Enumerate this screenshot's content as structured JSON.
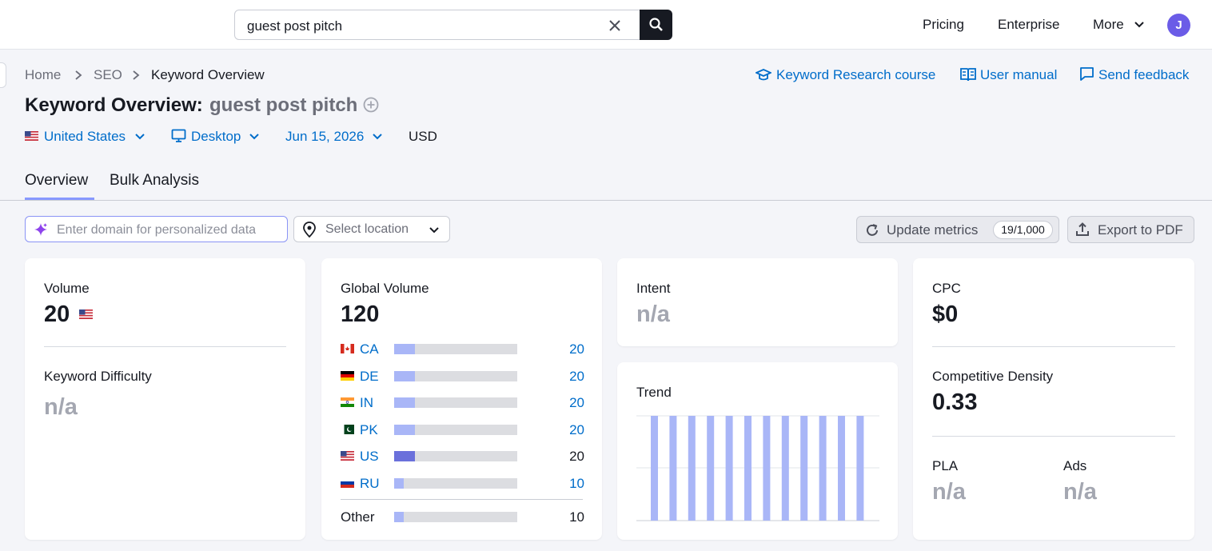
{
  "search": {
    "value": "guest post pitch"
  },
  "topnav": {
    "pricing": "Pricing",
    "enterprise": "Enterprise",
    "more": "More",
    "avatar_initial": "J"
  },
  "breadcrumb": {
    "home": "Home",
    "seo": "SEO",
    "current": "Keyword Overview"
  },
  "help_links": {
    "course": "Keyword Research course",
    "manual": "User manual",
    "feedback": "Send feedback"
  },
  "page": {
    "title": "Keyword Overview:",
    "keyword": "guest post pitch"
  },
  "filters": {
    "country": "United States",
    "device": "Desktop",
    "date": "Jun 15, 2026",
    "currency": "USD"
  },
  "tabs": [
    {
      "label": "Overview",
      "active": true
    },
    {
      "label": "Bulk Analysis",
      "active": false
    }
  ],
  "controls": {
    "domain_placeholder": "Enter domain for personalized data",
    "location_placeholder": "Select location",
    "update_label": "Update metrics",
    "update_count": "19/1,000",
    "export_label": "Export to PDF"
  },
  "volume_card": {
    "label": "Volume",
    "value": "20",
    "kd_label": "Keyword Difficulty",
    "kd_value": "n/a"
  },
  "global_card": {
    "label": "Global Volume",
    "value": "120",
    "countries": [
      {
        "code": "CA",
        "value": "20",
        "share": 0.17
      },
      {
        "code": "DE",
        "value": "20",
        "share": 0.17
      },
      {
        "code": "IN",
        "value": "20",
        "share": 0.17
      },
      {
        "code": "PK",
        "value": "20",
        "share": 0.17
      },
      {
        "code": "US",
        "value": "20",
        "share": 0.17
      },
      {
        "code": "RU",
        "value": "10",
        "share": 0.08
      }
    ],
    "other_label": "Other",
    "other_value": "10",
    "other_share": 0.08
  },
  "intent_card": {
    "label": "Intent",
    "value": "n/a"
  },
  "trend_card": {
    "label": "Trend",
    "values": [
      1,
      1,
      1,
      1,
      1,
      1,
      1,
      1,
      1,
      1,
      1,
      1
    ]
  },
  "cpc_card": {
    "cpc_label": "CPC",
    "cpc_value": "$0",
    "cd_label": "Competitive Density",
    "cd_value": "0.33",
    "pla_label": "PLA",
    "pla_value": "n/a",
    "ads_label": "Ads",
    "ads_value": "n/a"
  },
  "colors": {
    "link": "#006dca",
    "accent": "#8899ff",
    "trend_bar": "#a9b6f7",
    "us_bar": "#6a70db",
    "avatar": "#6b5ce7"
  }
}
